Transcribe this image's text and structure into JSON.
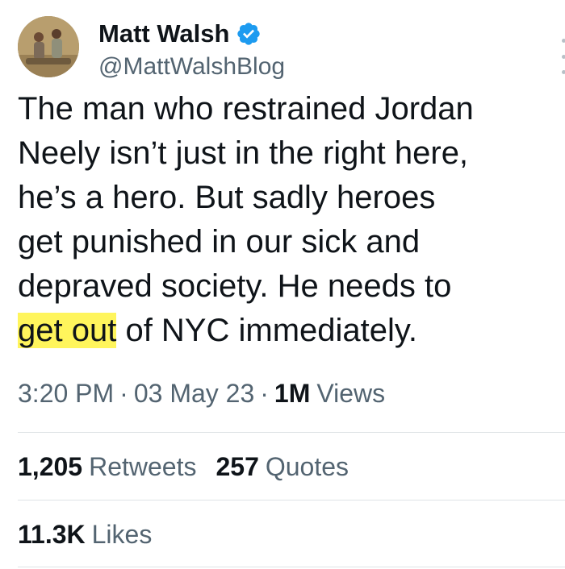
{
  "author": {
    "display_name": "Matt Walsh",
    "handle": "@MattWalshBlog"
  },
  "icons": {
    "verified": "verified-badge-icon",
    "more": "more-options-icon"
  },
  "colors": {
    "verified_blue": "#1d9bf0",
    "highlight": "#fff55c",
    "secondary_text": "#536471"
  },
  "tweet": {
    "lines": [
      "The man who restrained Jordan",
      "Neely isn’t just in the right here,",
      "he’s a hero. But sadly heroes",
      "get punished in our sick and",
      "depraved society. He needs to"
    ],
    "last_line_highlight": "get out",
    "last_line_rest": " of NYC immediately."
  },
  "meta": {
    "time": "3:20 PM",
    "separator": "·",
    "date": "03 May 23",
    "views_count": "1M",
    "views_label": "Views"
  },
  "stats": {
    "retweets_count": "1,205",
    "retweets_label": "Retweets",
    "quotes_count": "257",
    "quotes_label": "Quotes",
    "likes_count": "11.3K",
    "likes_label": "Likes"
  }
}
